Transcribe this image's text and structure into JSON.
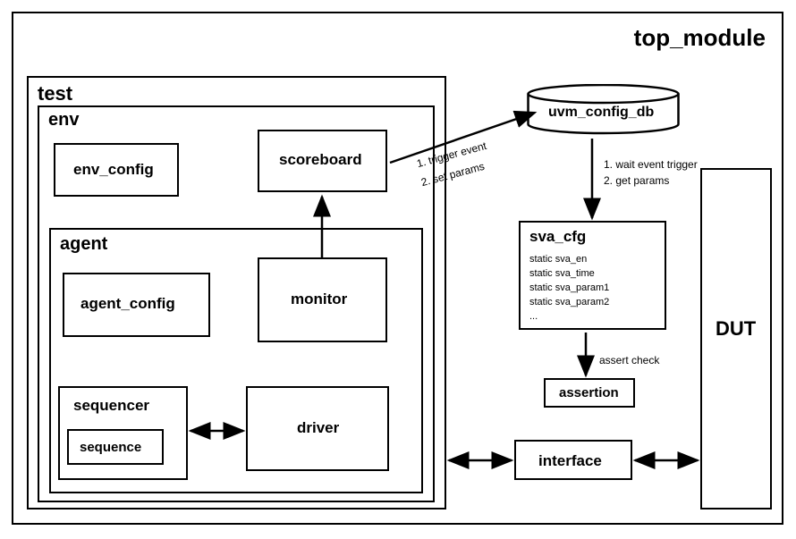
{
  "top_module": {
    "label": "top_module"
  },
  "test": {
    "label": "test"
  },
  "env": {
    "label": "env"
  },
  "env_config": {
    "label": "env_config"
  },
  "scoreboard": {
    "label": "scoreboard"
  },
  "agent": {
    "label": "agent"
  },
  "agent_config": {
    "label": "agent_config"
  },
  "monitor": {
    "label": "monitor"
  },
  "sequencer": {
    "label": "sequencer"
  },
  "sequence": {
    "label": "sequence"
  },
  "driver": {
    "label": "driver"
  },
  "uvm_config_db": {
    "label": "uvm_config_db"
  },
  "sva_cfg": {
    "label": "sva_cfg",
    "line1": "static sva_en",
    "line2": "static sva_time",
    "line3": "static sva_param1",
    "line4": "static sva_param2",
    "line5": "..."
  },
  "assertion": {
    "label": "assertion"
  },
  "interface": {
    "label": "interface"
  },
  "dut": {
    "label": "DUT"
  },
  "arrow_labels": {
    "scoreboard_to_db_1": "1. trigger event",
    "scoreboard_to_db_2": "2. set params",
    "db_to_sva_1": "1. wait event trigger",
    "db_to_sva_2": "2. get params",
    "assert_check": "assert check"
  }
}
